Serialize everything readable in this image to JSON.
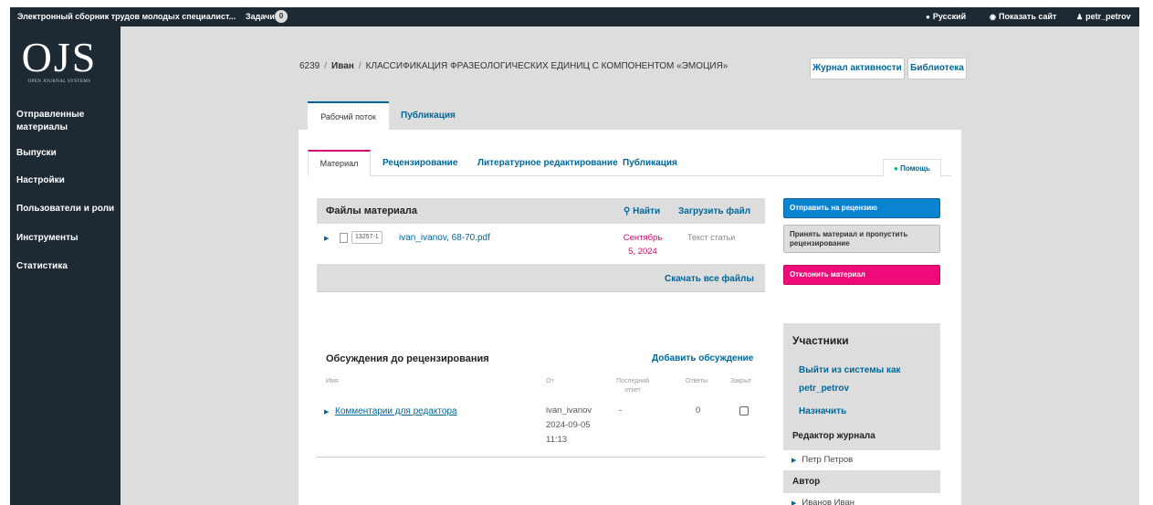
{
  "topbar": {
    "site_name": "Электронный сборник трудов молодых специалист...",
    "tasks_label": "Задачи",
    "tasks_count": "0",
    "language": "Русский",
    "view_site": "Показать сайт",
    "user": "petr_petrov"
  },
  "logo": {
    "text": "OJS",
    "subtitle": "OPEN JOURNAL SYSTEMS"
  },
  "sidebar": {
    "items": [
      {
        "label": "Отправленные материалы"
      },
      {
        "label": "Выпуски"
      },
      {
        "label": "Настройки"
      },
      {
        "label": "Пользователи и роли"
      },
      {
        "label": "Инструменты"
      },
      {
        "label": "Статистика"
      }
    ]
  },
  "header": {
    "submission_id": "6239",
    "author": "Иван",
    "title": "КЛАССИФИКАЦИЯ ФРАЗЕОЛОГИЧЕСКИХ ЕДИНИЦ С КОМПОНЕНТОМ «ЭМОЦИЯ»",
    "activity_log": "Журнал активности",
    "library": "Библиотека"
  },
  "main_tabs": [
    "Рабочий поток",
    "Публикация"
  ],
  "stage_tabs": [
    "Материал",
    "Рецензирование",
    "Литературное редактирование",
    "Публикация"
  ],
  "help_label": "Помощь",
  "files": {
    "title": "Файлы материала",
    "search": "Найти",
    "upload": "Загрузить файл",
    "rows": [
      {
        "id": "13257-1",
        "name": "ivan_ivanov, 68-70.pdf",
        "date_line1": "Сентябрь",
        "date_line2": "5, 2024",
        "type": "Текст статьи"
      }
    ],
    "download_all": "Скачать все файлы"
  },
  "discussions": {
    "title": "Обсуждения до рецензирования",
    "add": "Добавить обсуждение",
    "columns": {
      "name": "Имя",
      "from": "От",
      "last_line1": "Последний",
      "last_line2": "ответ",
      "replies": "Ответы",
      "closed": "Закрыт"
    },
    "rows": [
      {
        "name": "Комментарии для редактора",
        "from_user": "ivan_ivanov",
        "from_date": "2024-09-05",
        "from_time": "11:13",
        "last": "-",
        "replies": "0",
        "closed": false
      }
    ]
  },
  "actions": {
    "send_review": "Отправить на рецензию",
    "accept_line1": "Принять материал и пропустить",
    "accept_line2": "рецензирование",
    "decline": "Отклонить материал"
  },
  "participants": {
    "title": "Участники",
    "logout_as_line1": "Выйти из системы как",
    "logout_as_line2": "petr_petrov",
    "assign": "Назначить",
    "roles": [
      {
        "role": "Редактор журнала",
        "people": [
          "Петр Петров"
        ]
      },
      {
        "role": "Автор",
        "people": [
          "Иванов Иван"
        ]
      }
    ]
  },
  "colors": {
    "dark": "#1e2a33",
    "link": "#006798",
    "accent_pink": "#d00a6c",
    "send_blue": "#0a84d0",
    "accept_gray": "#dddddd",
    "decline_pink": "#ee0a78"
  }
}
